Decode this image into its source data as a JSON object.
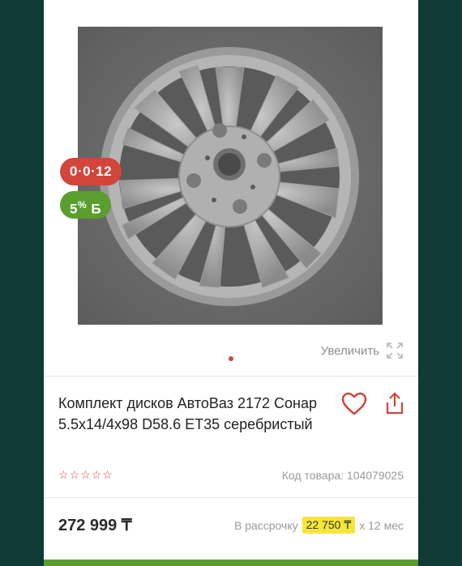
{
  "product": {
    "badges": {
      "timer": "0·0·12",
      "bonus_value": "5",
      "bonus_symbol": "%",
      "bonus_suffix": "Б"
    },
    "zoom_label": "Увеличить",
    "title": "Комплект дисков АвтоВаз 2172 Сонар 5.5x14/4x98 D58.6 ET35 серебристый",
    "code_label": "Код товара: 104079025",
    "price": "272 999 ₸",
    "installment": {
      "prefix": "В рассрочку",
      "amount": "22 750 ₸",
      "suffix": "х 12 мес"
    },
    "rating_stars": 0
  },
  "colors": {
    "background": "#0f3a36",
    "accent_red": "#d1453b",
    "accent_green": "#5a9e2f",
    "installment_highlight": "#f6e53a"
  },
  "icons": [
    "heart-icon",
    "share-icon",
    "expand-icon",
    "star-outline-icon"
  ]
}
